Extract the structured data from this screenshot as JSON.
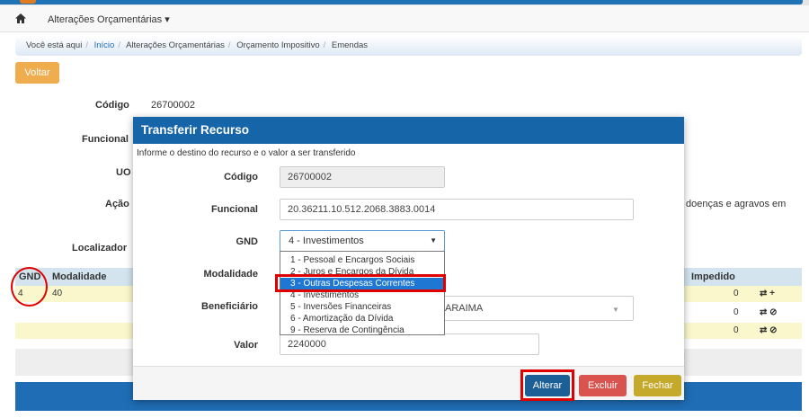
{
  "nav": {
    "menu_label": "Alterações Orçamentárias ▾"
  },
  "breadcrumb": {
    "here": "Você está aqui",
    "items": [
      "Início",
      "Alterações Orçamentárias",
      "Orçamento Impositivo",
      "Emendas"
    ]
  },
  "page": {
    "voltar": "Voltar",
    "codigo_label": "Código",
    "codigo_value": "26700002",
    "funcional_label": "Funcional",
    "uo_label": "UO",
    "acao_label": "Ação",
    "acao_value_tail": "doenças e agravos em",
    "localizador_label": "Localizador"
  },
  "table": {
    "headers": [
      "GND",
      "Modalidade",
      "Impedido"
    ],
    "rows": [
      {
        "gnd": "4",
        "modalidade": "40",
        "impedido": "0",
        "actions": "⇄ +"
      },
      {
        "gnd": "",
        "modalidade": "",
        "impedido": "0",
        "actions": "⇄ ⊘"
      },
      {
        "gnd": "",
        "modalidade": "",
        "impedido": "0",
        "actions": "⇄ ⊘"
      }
    ]
  },
  "modal": {
    "title": "Transferir Recurso",
    "subtitle": "Informe o destino do recurso e o valor a ser transferido",
    "codigo_label": "Código",
    "codigo_value": "26700002",
    "funcional_label": "Funcional",
    "funcional_value": "20.36211.10.512.2068.3883.0014",
    "gnd_label": "GND",
    "gnd_selected": "4 - Investimentos",
    "gnd_options": [
      "1 - Pessoal e Encargos Sociais",
      "2 - Juros e Encargos da Dívida",
      "3 - Outras Despesas Correntes",
      "4 - Investimentos",
      "5 - Inversões Financeiras",
      "6 - Amortização da Dívida",
      "9 - Reserva de Contingência"
    ],
    "highlighted_option_index": 2,
    "modalidade_label": "Modalidade",
    "beneficiario_label": "Beneficiário",
    "beneficiario_value_tail": "ARAIMA",
    "valor_label": "Valor",
    "valor_value": "2240000",
    "buttons": {
      "alterar": "Alterar",
      "excluir": "Excluir",
      "fechar": "Fechar"
    }
  },
  "colors": {
    "primary": "#1565a8",
    "warning": "#f0ad4e",
    "danger": "#d9534f",
    "annotation": "#e00000"
  }
}
